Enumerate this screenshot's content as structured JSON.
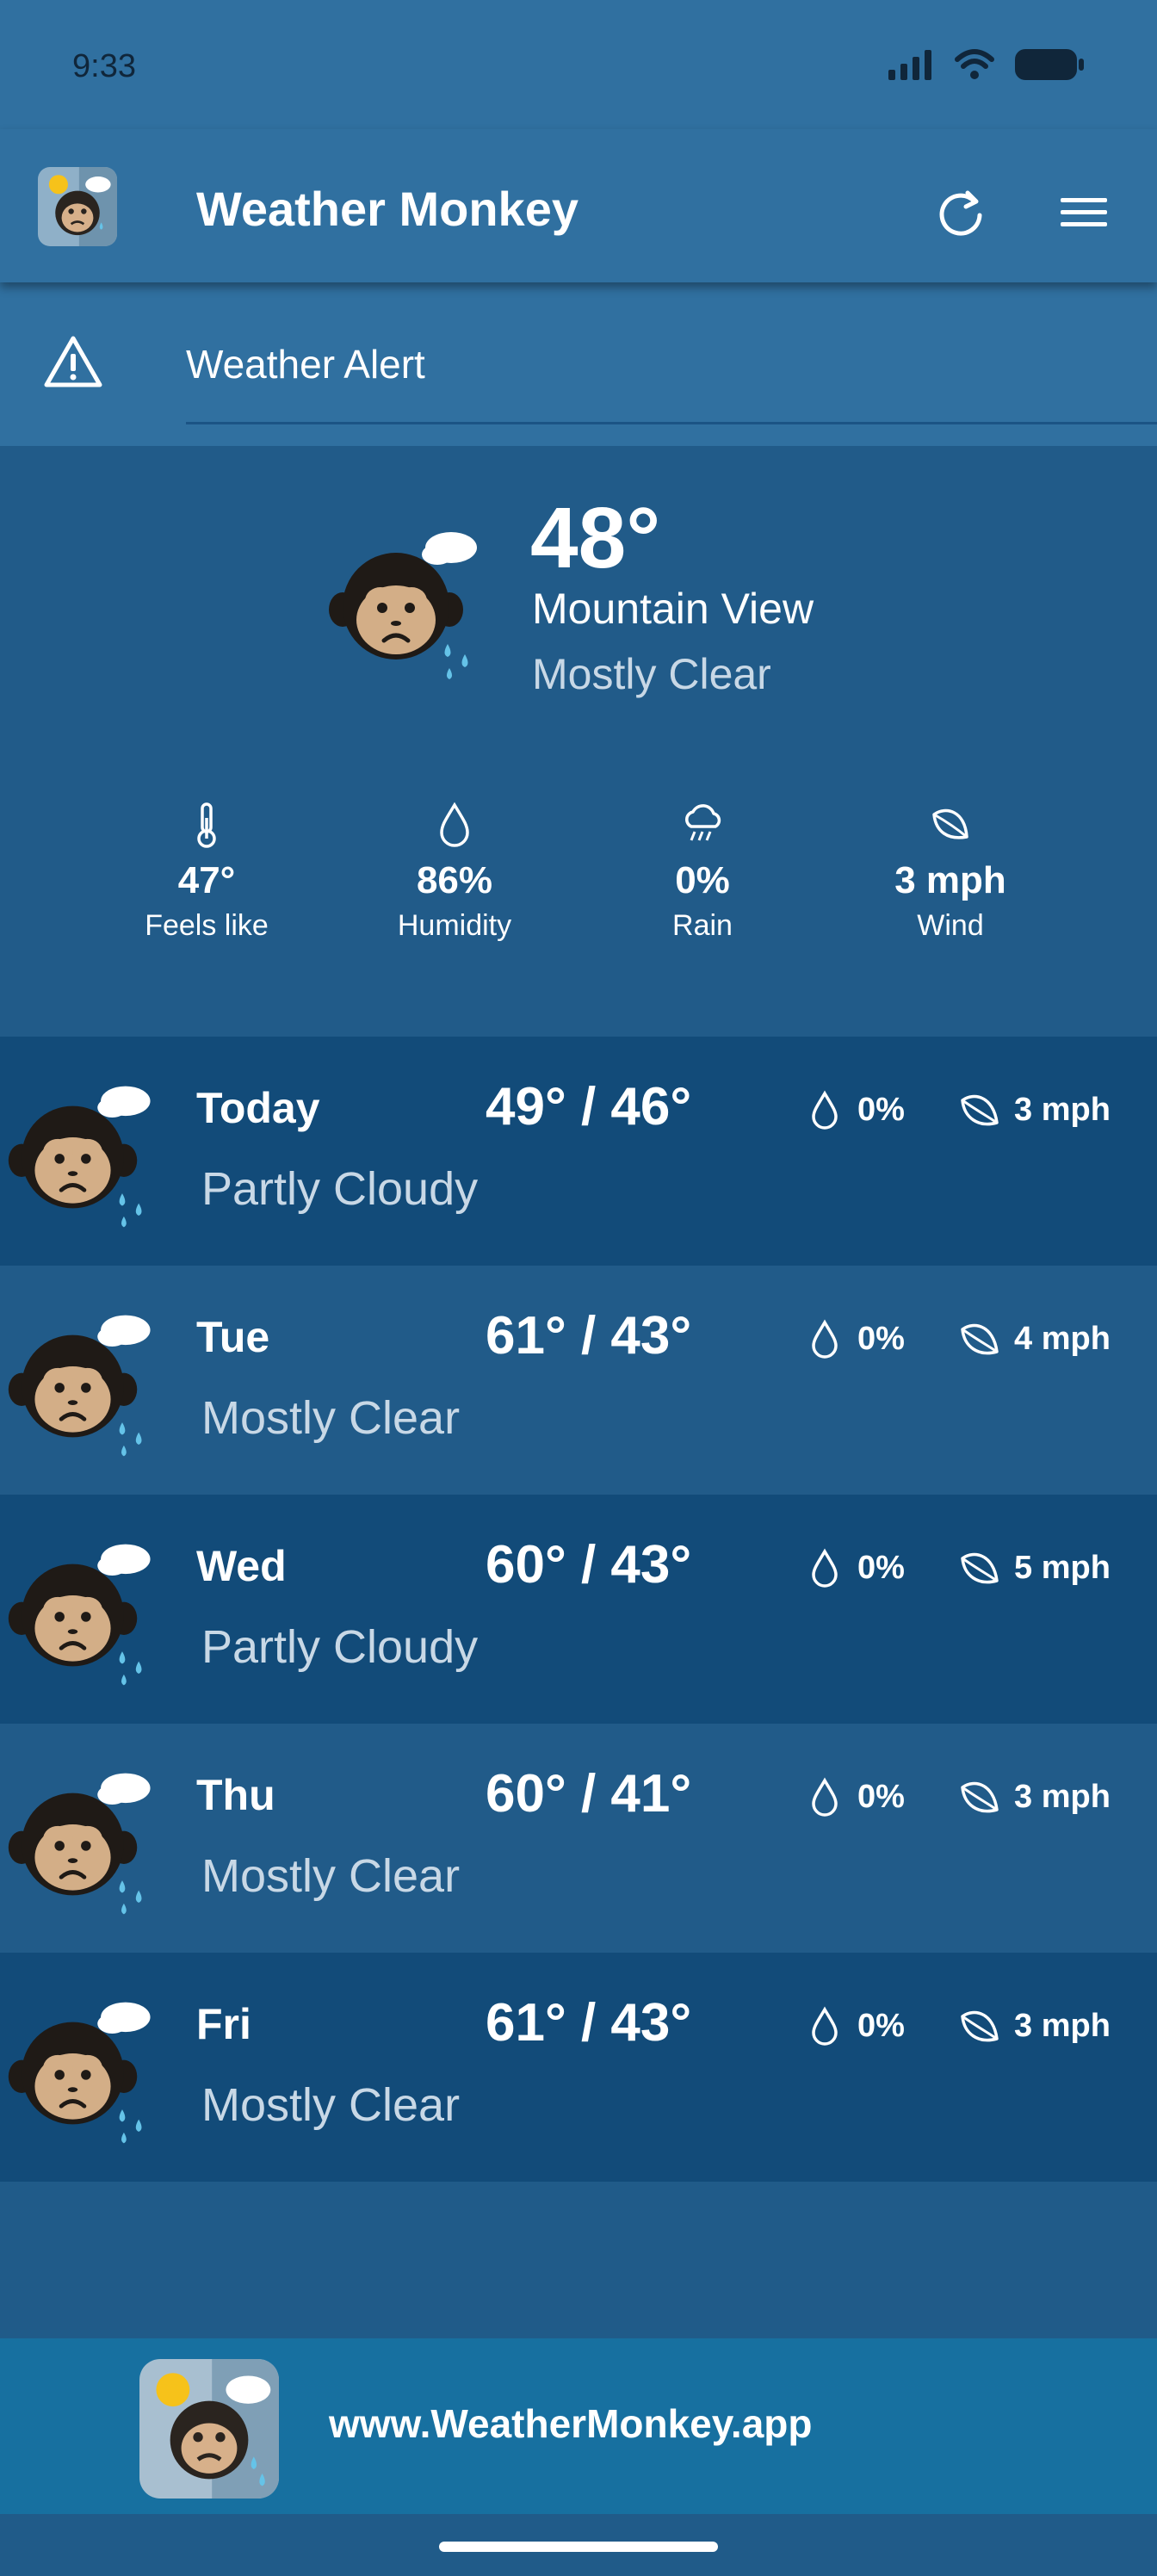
{
  "status_bar": {
    "time": "9:33"
  },
  "app_bar": {
    "title": "Weather Monkey"
  },
  "alert": {
    "label": "Weather Alert"
  },
  "current": {
    "temp": "48°",
    "city": "Mountain View",
    "condition": "Mostly Clear",
    "metrics": [
      {
        "icon": "thermometer-icon",
        "value": "47°",
        "label": "Feels like"
      },
      {
        "icon": "droplet-icon",
        "value": "86%",
        "label": "Humidity"
      },
      {
        "icon": "rain-cloud-icon",
        "value": "0%",
        "label": "Rain"
      },
      {
        "icon": "leaf-icon",
        "value": "3 mph",
        "label": "Wind"
      }
    ]
  },
  "forecast": [
    {
      "day": "Today",
      "temps": "49° / 46°",
      "condition": "Partly Cloudy",
      "precip": "0%",
      "wind": "3 mph"
    },
    {
      "day": "Tue",
      "temps": "61° / 43°",
      "condition": "Mostly Clear",
      "precip": "0%",
      "wind": "4 mph"
    },
    {
      "day": "Wed",
      "temps": "60° / 43°",
      "condition": "Partly Cloudy",
      "precip": "0%",
      "wind": "5 mph"
    },
    {
      "day": "Thu",
      "temps": "60° / 41°",
      "condition": "Mostly Clear",
      "precip": "0%",
      "wind": "3 mph"
    },
    {
      "day": "Fri",
      "temps": "61° / 43°",
      "condition": "Mostly Clear",
      "precip": "0%",
      "wind": "3 mph"
    }
  ],
  "footer": {
    "url": "www.WeatherMonkey.app"
  },
  "colors": {
    "app_bar": "#3070a0",
    "background": "#205b89",
    "row_dark": "#124b79",
    "row_light": "#215b89",
    "footer": "#1770a0",
    "secondary_text": "#c8d8e6"
  }
}
